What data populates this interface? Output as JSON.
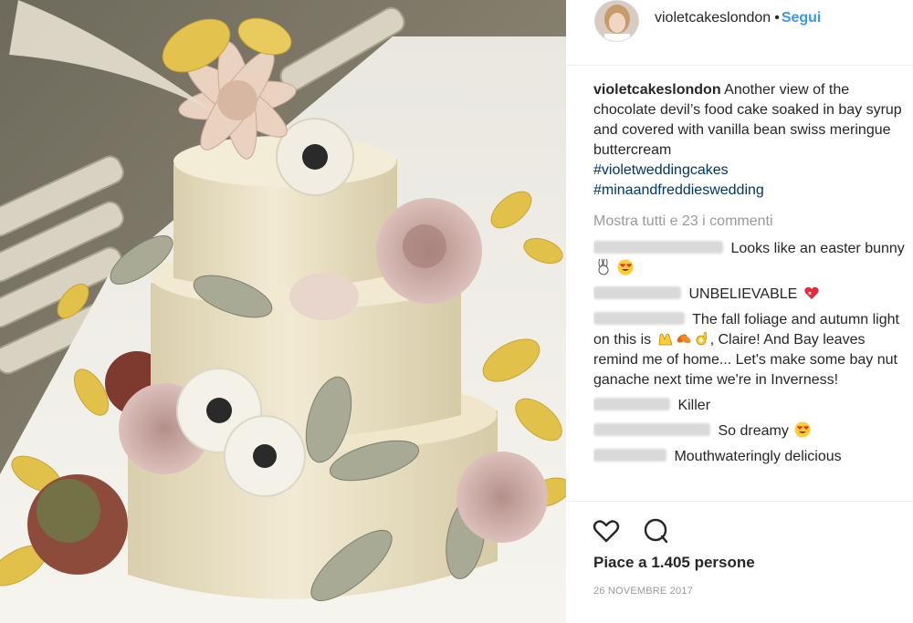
{
  "photo": {
    "subject": "three-tier buttercream cake with sugar flowers and autumn leaves"
  },
  "header": {
    "username": "violetcakeslondon",
    "separator": "•",
    "follow_label": "Segui"
  },
  "caption": {
    "username": "violetcakeslondon",
    "text": "Another view of the chocolate devil’s food cake soaked in bay syrup and covered with vanilla bean swiss meringue buttercream",
    "hashtags": [
      "#violetweddingcakes",
      "#minaandfreddieswedding"
    ]
  },
  "view_all_comments": "Mostra tutti e 23 i commenti",
  "comments": [
    {
      "text": "Looks like an easter bunny",
      "emojis": [
        "rabbit",
        "heart-eyes"
      ]
    },
    {
      "text": "UNBELIEVABLE",
      "emojis": [
        "sparkling-heart"
      ]
    },
    {
      "text_before": "The fall foliage and autumn light on this is",
      "emojis": [
        "raised-hands",
        "leaves",
        "ok-hand"
      ],
      "text_after": ", Claire! And Bay leaves remind me of home... Let's make some bay nut ganache next time we're in Inverness!"
    },
    {
      "text": "Killer",
      "emojis": []
    },
    {
      "text": "So dreamy",
      "emojis": [
        "heart-eyes"
      ]
    },
    {
      "text": "Mouthwateringly delicious",
      "emojis": []
    }
  ],
  "likes": "Piace a 1.405 persone",
  "date": "26 NOVEMBRE 2017",
  "icons": {
    "like": "heart-icon",
    "comment": "comment-icon"
  }
}
